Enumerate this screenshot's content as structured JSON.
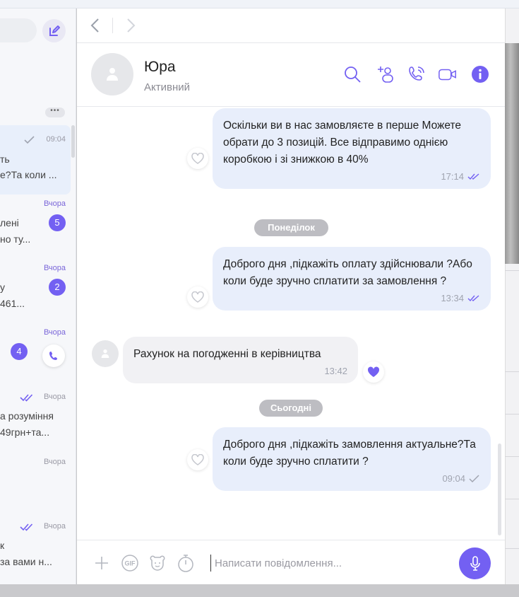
{
  "left": {
    "more_label": "•••",
    "chats": [
      {
        "time": "09:04",
        "line1": "ть",
        "line2": "е?Та коли ..."
      },
      {
        "time": "Вчора",
        "line1": "лені",
        "line2": "но ту...",
        "badge": "5"
      },
      {
        "time": "Вчора",
        "line1": "у",
        "line2": "461...",
        "badge": "2"
      },
      {
        "time": "Вчора",
        "badge": "4"
      },
      {
        "time": "Вчора",
        "line1": "а розуміння",
        "line2": "49грн+та..."
      },
      {
        "time": "Вчора"
      },
      {
        "time": "Вчора",
        "line1": "к",
        "line2": "за вами н..."
      }
    ]
  },
  "contact": {
    "name": "Юра",
    "status": "Активний"
  },
  "messages": [
    {
      "text": "Оскільки ви в нас замовляєте в перше Можете обрати до 3 позицій. Все відправимо однією коробкою і зі знижкою в 40%",
      "time": "17:14"
    },
    {
      "date": "Понеділок"
    },
    {
      "text": "Доброго дня ,підкажіть оплату здійснювали ?Або коли буде зручно сплатити за замовлення ?",
      "time": "13:34"
    },
    {
      "text": "Рахунок на погодженні в керівництва",
      "time": "13:42"
    },
    {
      "date": "Сьогодні"
    },
    {
      "text": "Доброго дня ,підкажіть замовлення актуальне?Та коли  буде зручно сплатити ?",
      "time": "09:04"
    }
  ],
  "composer": {
    "placeholder": "Написати повідомлення..."
  },
  "colors": {
    "accent": "#7360f2",
    "bubble_out": "#e8eefb",
    "bubble_in": "#f1f1f4"
  }
}
